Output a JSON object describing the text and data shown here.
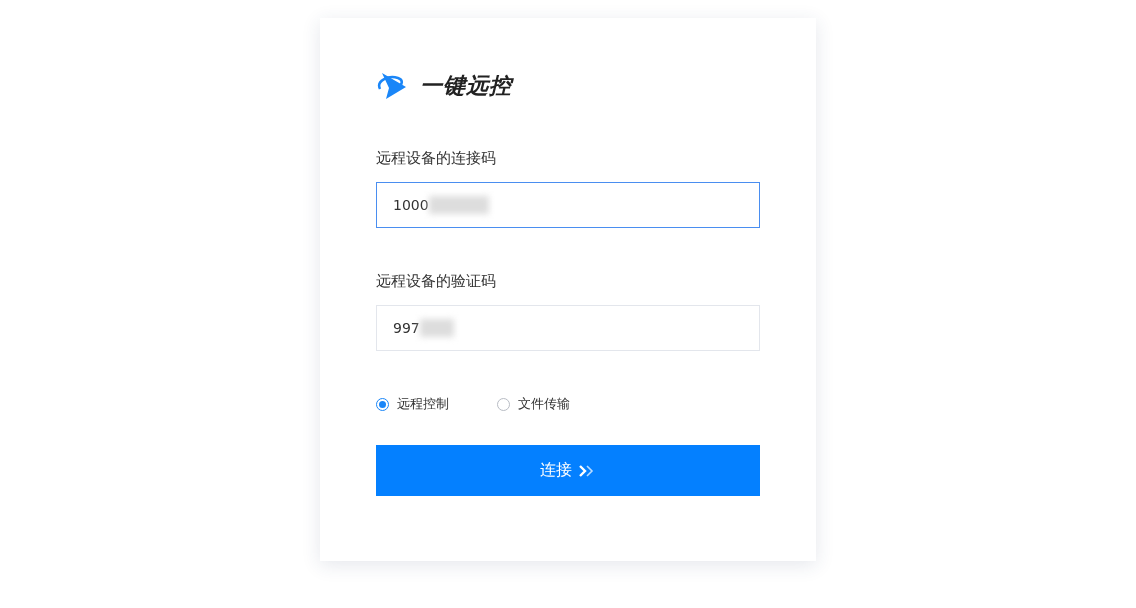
{
  "brand": {
    "name": "一键远控"
  },
  "fields": [
    {
      "label": "远程设备的连接码",
      "value": "1000",
      "focused": true
    },
    {
      "label": "远程设备的验证码",
      "value": "997",
      "focused": false
    }
  ],
  "modes": [
    {
      "label": "远程控制",
      "selected": true
    },
    {
      "label": "文件传输",
      "selected": false
    }
  ],
  "connect_button": {
    "label": "连接"
  }
}
